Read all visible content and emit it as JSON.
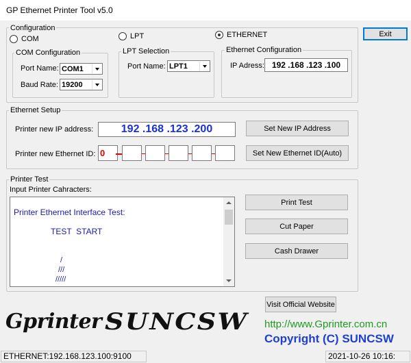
{
  "window": {
    "title": "GP Ethernet Printer Tool v5.0"
  },
  "exit_label": "Exit",
  "configuration": {
    "legend": "Configuration",
    "mode_com": "COM",
    "mode_lpt": "LPT",
    "mode_ethernet": "ETHERNET",
    "selected_mode": "ETHERNET",
    "com": {
      "legend": "COM Configuration",
      "port_label": "Port Name:",
      "port_value": "COM1",
      "baud_label": "Baud Rate:",
      "baud_value": "19200"
    },
    "lpt": {
      "legend": "LPT Selection",
      "port_label": "Port Name:",
      "port_value": "LPT1"
    },
    "ethernet": {
      "legend": "Ethernet Configuration",
      "ip_label": "IP Adress:",
      "ip_value": "192 .168 .123 .100"
    }
  },
  "ethernet_setup": {
    "legend": "Ethernet Setup",
    "new_ip_label": "Printer new IP address:",
    "new_ip_value": "192 .168 .123 .200",
    "set_ip_button": "Set New IP Address",
    "new_id_label": "Printer new Ethernet ID:",
    "id_fields": [
      "0",
      "",
      "",
      "",
      "",
      ""
    ],
    "set_id_button": "Set New Ethernet ID(Auto)"
  },
  "printer_test": {
    "legend": "Printer Test",
    "input_label": "Input Printer Cahracters:",
    "text_lines": [
      "Printer Ethernet Interface Test:",
      "TEST  START",
      "/",
      "///",
      "/////"
    ],
    "print_test_button": "Print Test",
    "cut_paper_button": "Cut Paper",
    "cash_drawer_button": "Cash Drawer"
  },
  "visit_website_button": "Visit Official Website",
  "branding": {
    "logo_left": "Gprinter",
    "logo_right": "SUNCSW",
    "url": "http://www.Gprinter.com.cn",
    "copyright": "Copyright (C) SUNCSW"
  },
  "status": {
    "connection": "ETHERNET:192.168.123.100:9100",
    "datetime": "2021-10-26 10:16:"
  },
  "colors": {
    "ip_blue": "#1a2fd6",
    "id_red": "#e00000",
    "text_blue": "#1a1aa6",
    "link_green": "#1f9a1f",
    "copyright_blue": "#1e3fcf"
  }
}
